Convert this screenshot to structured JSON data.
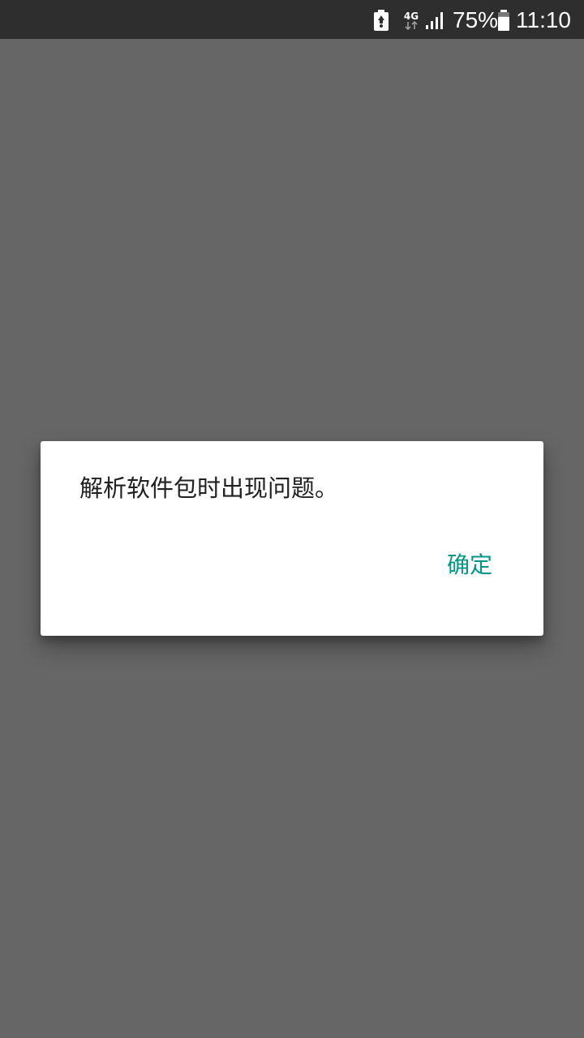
{
  "status_bar": {
    "network_type": "4G",
    "battery_percent": "75%",
    "time": "11:10",
    "icons": [
      "battery-saver-icon",
      "network-4g-icon",
      "signal-icon",
      "battery-icon"
    ]
  },
  "dialog": {
    "message": "解析软件包时出现问题。",
    "ok_label": "确定"
  },
  "colors": {
    "status_bar_bg": "#2e2e2e",
    "scrim": "#666666",
    "dialog_bg": "#ffffff",
    "text_primary": "#212121",
    "accent": "#009688"
  }
}
